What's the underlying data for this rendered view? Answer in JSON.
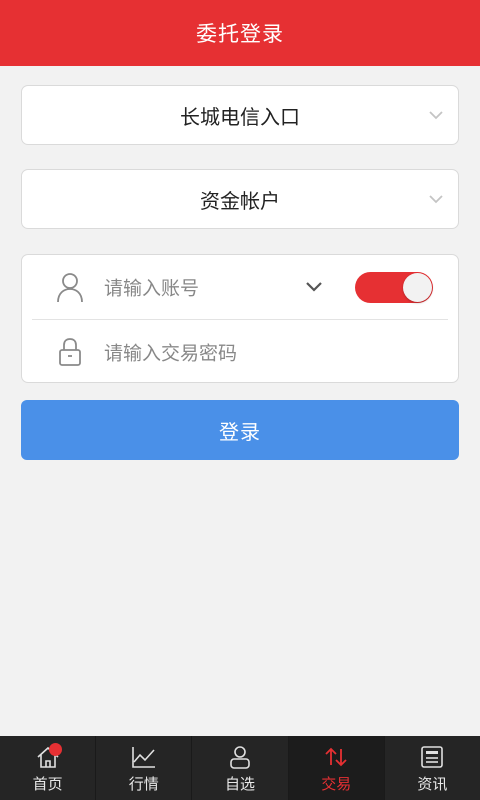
{
  "header": {
    "title": "委托登录"
  },
  "broker_select": {
    "value": "长城电信入口"
  },
  "account_type_select": {
    "value": "资金帐户"
  },
  "login_form": {
    "account_placeholder": "请输入账号",
    "password_placeholder": "请输入交易密码",
    "remember_toggle_on": true
  },
  "login_button": {
    "label": "登录"
  },
  "tabbar": {
    "items": [
      {
        "label": "首页",
        "icon": "home-icon",
        "has_badge": true
      },
      {
        "label": "行情",
        "icon": "chart-line-icon"
      },
      {
        "label": "自选",
        "icon": "user-icon"
      },
      {
        "label": "交易",
        "icon": "exchange-arrows-icon",
        "active": true
      },
      {
        "label": "资讯",
        "icon": "news-icon"
      }
    ]
  },
  "colors": {
    "header_bg": "#e63033",
    "primary_button": "#4a90e8",
    "toggle_on": "#e63033",
    "active_tab_text": "#e63033",
    "tabbar_bg": "#252525",
    "page_bg": "#f2f2f2"
  }
}
